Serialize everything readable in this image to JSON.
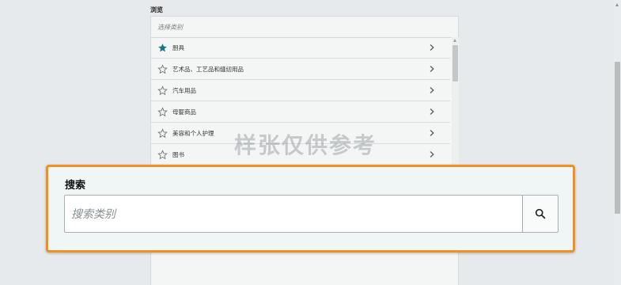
{
  "browse": {
    "title": "浏览",
    "header_placeholder": "选择类别",
    "items": [
      {
        "label": "厨具",
        "starred": true
      },
      {
        "label": "艺术品、工艺品和缝纫用品",
        "starred": false
      },
      {
        "label": "汽车用品",
        "starred": false
      },
      {
        "label": "母婴商品",
        "starred": false
      },
      {
        "label": "美容和个人护理",
        "starred": false
      },
      {
        "label": "图书",
        "starred": false
      }
    ]
  },
  "watermark": "样张仅供参考",
  "search": {
    "label": "搜索",
    "placeholder": "搜索类别",
    "value": ""
  },
  "colors": {
    "star_filled": "#137a8c",
    "star_outline": "#6d7374",
    "highlight_border": "#f0901e"
  },
  "icons": {
    "star_filled": "star-filled-icon",
    "star_outline": "star-outline-icon",
    "chevron": "chevron-right-icon",
    "search": "search-icon"
  }
}
